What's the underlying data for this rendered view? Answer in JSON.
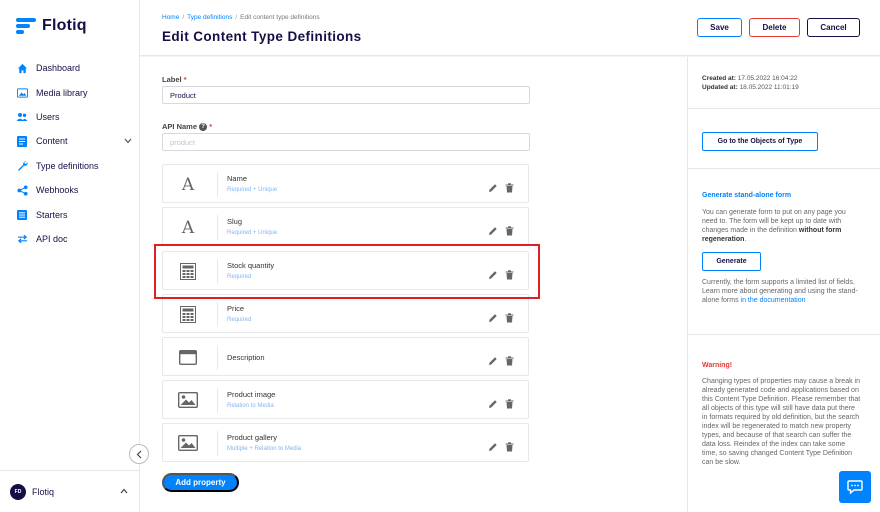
{
  "app": {
    "name": "Flotiq"
  },
  "sidebar": {
    "items": [
      {
        "label": "Dashboard",
        "icon": "home-icon"
      },
      {
        "label": "Media library",
        "icon": "image-icon"
      },
      {
        "label": "Users",
        "icon": "users-icon"
      },
      {
        "label": "Content",
        "icon": "content-icon",
        "expandable": true
      },
      {
        "label": "Type definitions",
        "icon": "wrench-icon"
      },
      {
        "label": "Webhooks",
        "icon": "share-icon"
      },
      {
        "label": "Starters",
        "icon": "list-icon"
      },
      {
        "label": "API doc",
        "icon": "swap-icon"
      }
    ],
    "user": {
      "initials": "FD",
      "name": "Flotiq"
    }
  },
  "header": {
    "breadcrumb": {
      "home": "Home",
      "section": "Type definitions",
      "current": "Edit content type definitions"
    },
    "title": "Edit Content Type Definitions",
    "save_label": "Save",
    "delete_label": "Delete",
    "cancel_label": "Cancel"
  },
  "form": {
    "label_field": {
      "label": "Label",
      "required_mark": "*",
      "value": "Product"
    },
    "api_name_field": {
      "label": "API Name",
      "help_mark": "?",
      "required_mark": "*",
      "placeholder": "product"
    },
    "properties": [
      {
        "name": "Name",
        "meta": "Required + Unique",
        "icon": "text-icon"
      },
      {
        "name": "Slug",
        "meta": "Required + Unique",
        "icon": "text-icon"
      },
      {
        "name": "Stock quantity",
        "meta": "Required",
        "icon": "calculator-icon"
      },
      {
        "name": "Price",
        "meta": "Required",
        "icon": "calculator-icon"
      },
      {
        "name": "Description",
        "meta": "",
        "icon": "textarea-icon"
      },
      {
        "name": "Product image",
        "meta": "Relation to Media",
        "icon": "image-icon"
      },
      {
        "name": "Product gallery",
        "meta": "Multiple + Relation to Media",
        "icon": "image-icon"
      }
    ],
    "add_property_label": "Add property"
  },
  "right_panel": {
    "created_label": "Created at:",
    "created_value": "17.05.2022 16:04:22",
    "updated_label": "Updated at:",
    "updated_value": "18.05.2022 11:01:19",
    "objects_button": "Go to the Objects of Type",
    "standalone": {
      "title": "Generate stand-alone form",
      "text_1": "You can generate form to put on any page you need to. The form will be kept up to date with changes made in the definition",
      "text_bold": "without form regeneration",
      "text_end": ".",
      "button": "Generate",
      "note": "Currently, the form supports a limited list of fields.",
      "learn_text": "Learn more about generating and using the stand-alone forms",
      "learn_link": "in the documentation"
    },
    "warning": {
      "title": "Warning!",
      "text": "Changing types of properties may cause a break in already generated code and applications based on this Content Type Definition. Please remember that all objects of this type will still have data put there in formats required by old definition, but the search index will be regenerated to match new property types, and because of that search can suffer the data loss. Reindex of the index can take some time, so saving changed Content Type Definition can be slow."
    }
  },
  "colors": {
    "accent": "#0083fc",
    "danger": "#e53935",
    "navy": "#141046"
  }
}
